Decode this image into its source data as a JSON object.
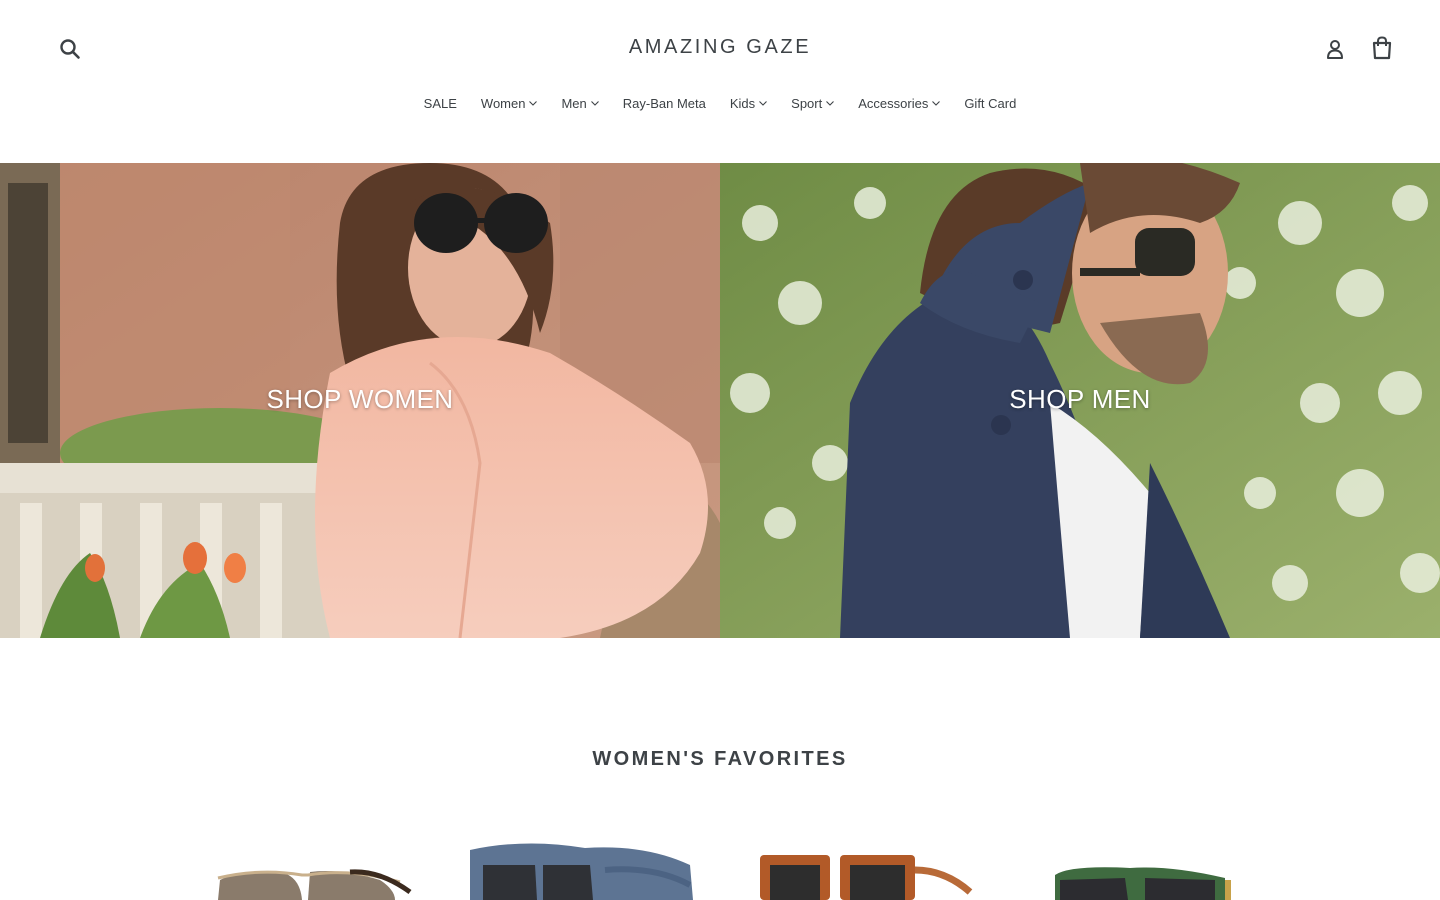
{
  "header": {
    "logo": "AMAZING GAZE",
    "search_icon": "search-icon",
    "login_icon": "user-icon",
    "cart_icon": "shopping-bag-icon"
  },
  "nav": {
    "items": [
      {
        "label": "SALE",
        "dropdown": false
      },
      {
        "label": "Women",
        "dropdown": true
      },
      {
        "label": "Men",
        "dropdown": true
      },
      {
        "label": "Ray-Ban Meta",
        "dropdown": false
      },
      {
        "label": "Kids",
        "dropdown": true
      },
      {
        "label": "Sport",
        "dropdown": true
      },
      {
        "label": "Accessories",
        "dropdown": true
      },
      {
        "label": "Gift Card",
        "dropdown": false
      }
    ]
  },
  "hero": {
    "women": {
      "label": "SHOP WOMEN"
    },
    "men": {
      "label": "SHOP MEN"
    }
  },
  "favorites": {
    "title": "WOMEN'S FAVORITES"
  },
  "colors": {
    "text": "#3d4246",
    "background": "#ffffff",
    "hero_label": "#ffffff"
  }
}
